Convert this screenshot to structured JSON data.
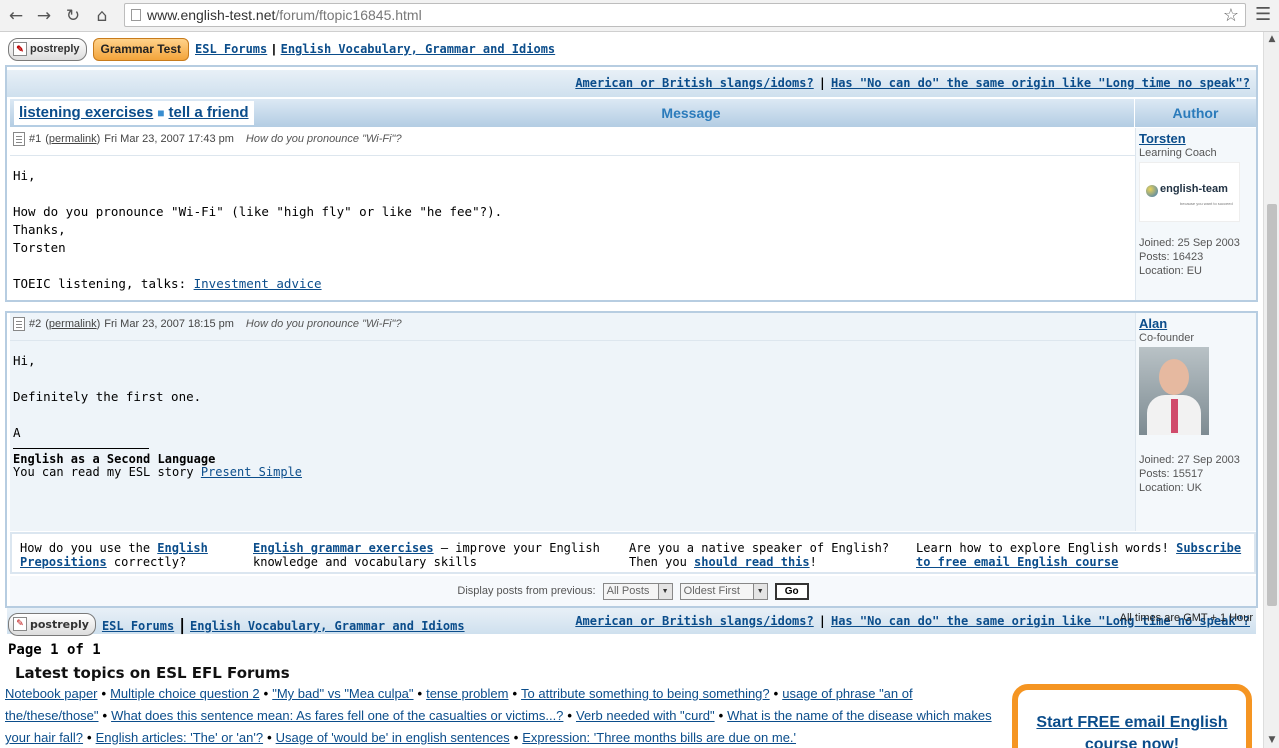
{
  "browser": {
    "url_domain": "www.english-test.net",
    "url_path": "/forum/ftopic16845.html"
  },
  "toolbar": {
    "postreply_label": "postreply",
    "grammar_test_label": "Grammar Test",
    "crumb_forums": "ESL Forums",
    "crumb_category": "English Vocabulary, Grammar and Idioms"
  },
  "topnav": {
    "prev_topic": "American or British slangs/idoms?",
    "next_topic": "Has \"No can do\" the same origin like \"Long time no speak\"?"
  },
  "table_header": {
    "listening_link": "listening exercises",
    "tell_friend_link": "tell a friend",
    "message_col": "Message",
    "author_col": "Author"
  },
  "posts": [
    {
      "number": "#1",
      "permalink": "permalink",
      "date": "Fri Mar 23, 2007 17:43 pm",
      "subject": "How do you pronounce \"Wi-Fi\"?",
      "lines": [
        "Hi,",
        "How do you pronounce \"Wi-Fi\" (like \"high fly\" or like \"he fee\"?).",
        "Thanks,",
        "Torsten"
      ],
      "sig_prefix": "TOEIC listening, talks: ",
      "sig_link": "Investment advice",
      "author": {
        "name": "Torsten",
        "rank": "Learning Coach",
        "avatar_text": "english-team",
        "avatar_subtext": "because you want to succeed",
        "joined": "Joined: 25 Sep 2003",
        "posts": "Posts: 16423",
        "location": "Location: EU"
      }
    },
    {
      "number": "#2",
      "permalink": "permalink",
      "date": "Fri Mar 23, 2007 18:15 pm",
      "subject": "How do you pronounce \"Wi-Fi\"?",
      "lines": [
        "Hi,",
        "Definitely the first one.",
        "A"
      ],
      "sig_title": "English as a Second Language",
      "sig_prefix": "You can read my ESL story ",
      "sig_link": "Present Simple",
      "author": {
        "name": "Alan",
        "rank": "Co-founder",
        "joined": "Joined: 27 Sep 2003",
        "posts": "Posts: 15517",
        "location": "Location: UK"
      }
    }
  ],
  "promo": {
    "p1_prefix": "How do you use the ",
    "p1_link": "English Prepositions",
    "p1_suffix": " correctly?",
    "p2_link": "English grammar exercises",
    "p2_suffix": " — improve your English knowledge and vocabulary skills",
    "p3_prefix": "Are you a native speaker of English? Then you ",
    "p3_link": "should read this",
    "p3_suffix": "!",
    "p4_prefix": "Learn how to explore English words! ",
    "p4_link": "Subscribe to free email English course"
  },
  "display": {
    "label": "Display posts from previous:",
    "posts_select": "All Posts",
    "order_select": "Oldest First",
    "go_label": "Go"
  },
  "footer": {
    "timezone": "All times are GMT + 1 Hour",
    "page": "Page 1 of 1",
    "latest_title": "Latest topics on ESL EFL Forums",
    "latest_topics": [
      "Notebook paper",
      "Multiple choice question 2",
      "\"My bad\" vs \"Mea culpa\"",
      "tense problem",
      "To attribute something to being something?",
      "usage of phrase \"an of the/these/those\"",
      "What does this sentence mean: As fares fell one of the casualties or victims...?",
      "Verb needed with \"curd\"",
      "What is the name of the disease which makes your hair fall?",
      "English articles: 'The' or 'an'?",
      "Usage of 'would be' in english sentences",
      "Expression: 'Three months bills are due on me.'"
    ],
    "cta_text": "Start FREE email English course now!"
  }
}
